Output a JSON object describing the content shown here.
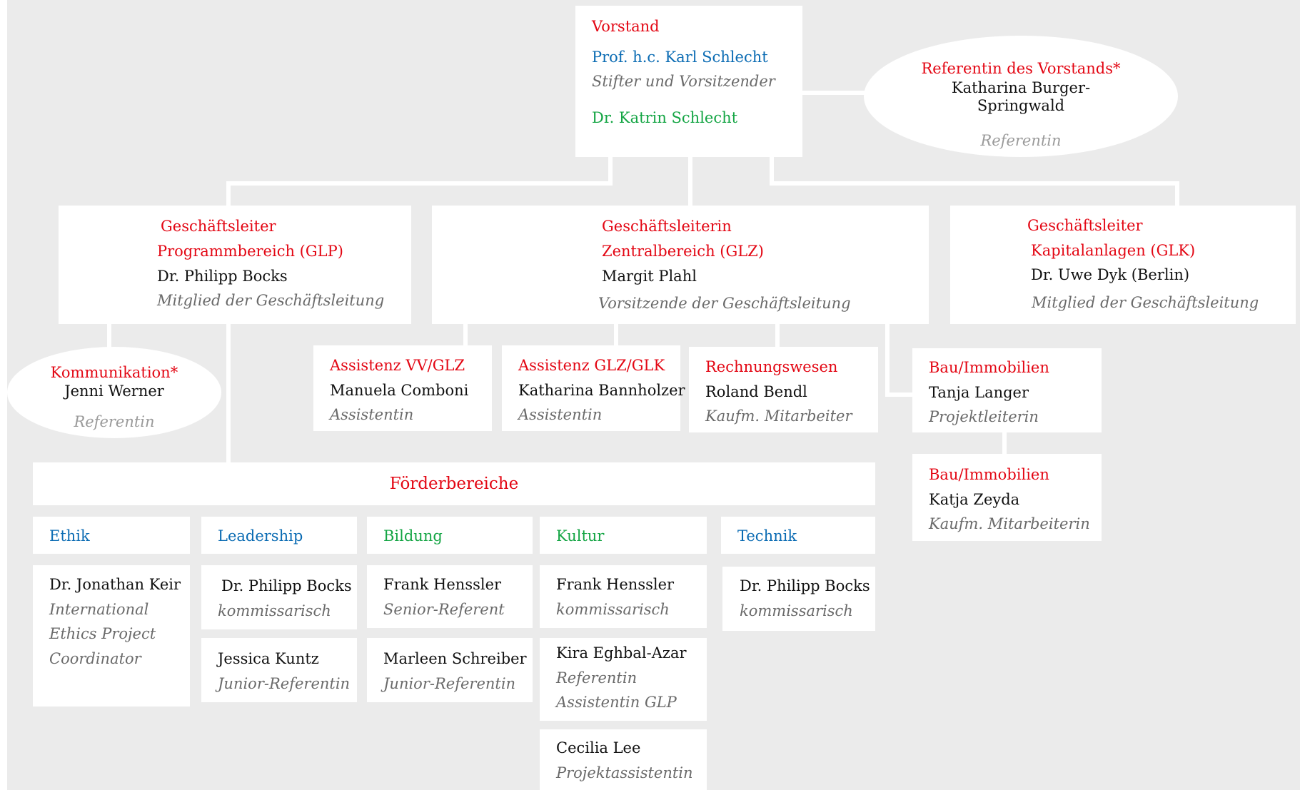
{
  "vorstand": {
    "title": "Vorstand",
    "member1_name": "Prof. h.c. Karl Schlecht",
    "member1_role": "Stifter und Vorsitzender",
    "member2_name": "Dr. Katrin Schlecht"
  },
  "referentin_vorstand": {
    "title": "Referentin des Vorstands*",
    "name_line1": "Katharina Burger-",
    "name_line2": "Springwald",
    "role": "Referentin"
  },
  "glp": {
    "title_line1": "Geschäftsleiter",
    "title_line2": "Programmbereich  (GLP)",
    "name": "Dr. Philipp Bocks",
    "role": "Mitglied der Geschäftsleitung"
  },
  "glz": {
    "title_line1": "Geschäftsleiterin",
    "title_line2": "Zentralbereich (GLZ)",
    "name": "Margit Plahl",
    "role": "Vorsitzende der Geschäftsleitung"
  },
  "glk": {
    "title_line1": "Geschäftsleiter",
    "title_line2": "Kapitalanlagen  (GLK)",
    "name": "Dr. Uwe Dyk   (Berlin)",
    "role": "Mitglied der Geschäftsleitung"
  },
  "kommunikation": {
    "title": "Kommunikation*",
    "name": "Jenni Werner",
    "role": "Referentin"
  },
  "assistenz_vv": {
    "title": "Assistenz VV/GLZ",
    "name": "Manuela Comboni",
    "role": "Assistentin"
  },
  "assistenz_glz": {
    "title": "Assistenz GLZ/GLK",
    "name": "Katharina Bannholzer",
    "role": "Assistentin"
  },
  "rechnungswesen": {
    "title": "Rechnungswesen",
    "name": "Roland Bendl",
    "role": "Kaufm. Mitarbeiter"
  },
  "bau1": {
    "title": "Bau/Immobilien",
    "name": "Tanja Langer",
    "role": "Projektleiterin"
  },
  "bau2": {
    "title": "Bau/Immobilien",
    "name": "Katja Zeyda",
    "role": "Kaufm. Mitarbeiterin"
  },
  "foerder": {
    "title": "Förderbereiche",
    "areas": [
      "Ethik",
      "Leadership",
      "Bildung",
      "Kultur",
      "Technik"
    ]
  },
  "ethik": [
    {
      "name": "Dr. Jonathan Keir",
      "role_lines": [
        "International",
        "Ethics Project",
        "Coordinator"
      ]
    }
  ],
  "leadership": [
    {
      "name": "Dr. Philipp Bocks",
      "role": "kommissarisch"
    },
    {
      "name": "Jessica Kuntz",
      "role": "Junior-Referentin"
    }
  ],
  "bildung": [
    {
      "name": "Frank Henssler",
      "role": "Senior-Referent"
    },
    {
      "name": "Marleen Schreiber",
      "role": "Junior-Referentin"
    }
  ],
  "kultur": [
    {
      "name": "Frank Henssler",
      "role": "kommissarisch"
    },
    {
      "name": "Kira Eghbal-Azar",
      "role_lines": [
        "Referentin",
        "Assistentin GLP"
      ]
    },
    {
      "name": "Cecilia Lee",
      "role": "Projektassistentin"
    }
  ],
  "technik": [
    {
      "name": "Dr. Philipp Bocks",
      "role": "kommissarisch"
    }
  ],
  "colors": {
    "background": "#ebebeb",
    "box": "#ffffff",
    "title_red": "#e30613",
    "blue": "#0a6bb3",
    "green": "#14a544",
    "role_grey": "#6a6a6a"
  }
}
